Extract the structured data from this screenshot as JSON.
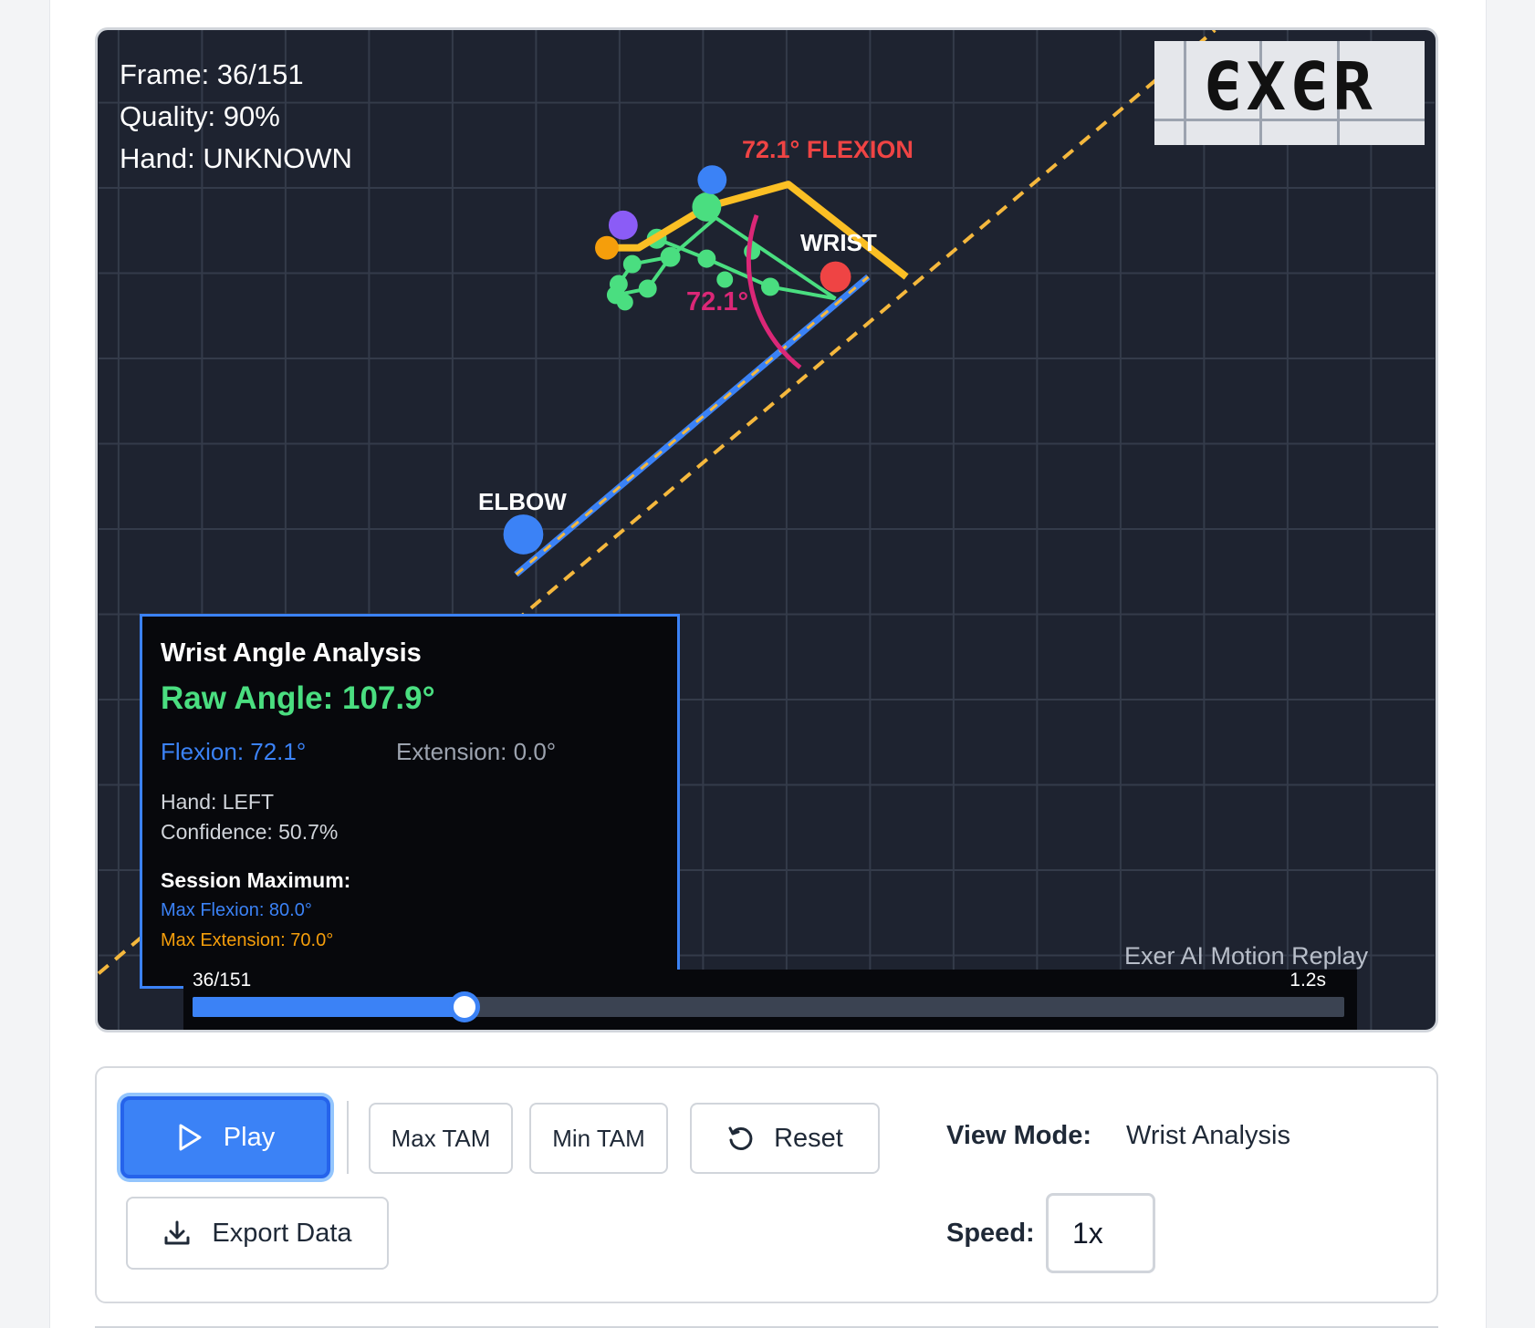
{
  "hud": {
    "frame": "Frame: 36/151",
    "quality": "Quality: 90%",
    "hand": "Hand: UNKNOWN"
  },
  "logo": {
    "text": "ЄXЄR"
  },
  "overlay": {
    "flexion_label": "72.1° FLEXION",
    "wrist_label": "WRIST",
    "elbow_label": "ELBOW",
    "arc_label": "72.1°"
  },
  "analysis": {
    "title": "Wrist Angle Analysis",
    "raw_angle": "Raw Angle: 107.9°",
    "flexion": "Flexion: 72.1°",
    "extension": "Extension: 0.0°",
    "hand": "Hand: LEFT",
    "confidence": "Confidence: 50.7%",
    "session_title": "Session Maximum:",
    "max_flexion": "Max Flexion: 80.0°",
    "max_extension": "Max Extension: 70.0°"
  },
  "timeline": {
    "frame_label": "36/151",
    "time_label": "1.2s",
    "progress": 0.232
  },
  "replay_label": "Exer AI Motion Replay",
  "controls": {
    "play": "Play",
    "max_tam": "Max TAM",
    "min_tam": "Min TAM",
    "reset": "Reset",
    "export": "Export Data",
    "view_mode_label": "View Mode:",
    "view_mode_value": "Wrist Analysis",
    "speed_label": "Speed:",
    "speed_value": "1x"
  },
  "colors": {
    "accent": "#3b82f6",
    "flexion_red": "#ef4444",
    "arc_pink": "#db2777",
    "raw_green": "#4ade80",
    "extension_orange": "#f59e0b",
    "hand_green": "#4ade80",
    "hand_orange": "#fbbf24"
  }
}
